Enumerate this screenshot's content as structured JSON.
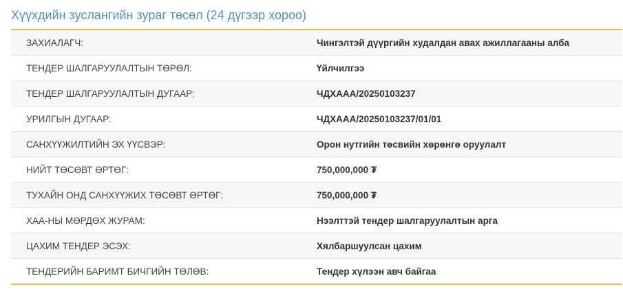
{
  "panel": {
    "title": "Хүүхдийн зуслангийн зураг төсөл (24 дүгээр хороо)"
  },
  "rows": [
    {
      "label": "ЗАХИАЛАГЧ:",
      "value": "Чингэлтэй дүүргийн худалдан авах ажиллагааны алба"
    },
    {
      "label": "ТЕНДЕР ШАЛГАРУУЛАЛТЫН ТӨРӨЛ:",
      "value": "Үйлчилгээ"
    },
    {
      "label": "ТЕНДЕР ШАЛГАРУУЛАЛТЫН ДУГААР:",
      "value": "ЧДХААА/20250103237"
    },
    {
      "label": "УРИЛГЫН ДУГААР:",
      "value": "ЧДХААА/20250103237/01/01"
    },
    {
      "label": "САНХҮҮЖИЛТИЙН ЭХ ҮҮСВЭР:",
      "value": "Орон нутгийн төсвийн хөрөнгө оруулалт"
    },
    {
      "label": "НИЙТ ТӨСӨВТ ӨРТӨГ:",
      "value": "750,000,000 ₮"
    },
    {
      "label": "ТУХАЙН ОНД САНХҮҮЖИХ ТӨСӨВТ ӨРТӨГ:",
      "value": "750,000,000 ₮"
    },
    {
      "label": "ХАА-НЫ МӨРДӨХ ЖУРАМ:",
      "value": "Нээлттэй тендер шалгаруулалтын арга"
    },
    {
      "label": "ЦАХИМ ТЕНДЕР ЭСЭХ:",
      "value": "Хялбаршуулсан цахим"
    },
    {
      "label": "ТЕНДЕРИЙН БАРИМТ БИЧГИЙН ТӨЛӨВ:",
      "value": "Тендер хүлээн авч байгаа"
    }
  ]
}
